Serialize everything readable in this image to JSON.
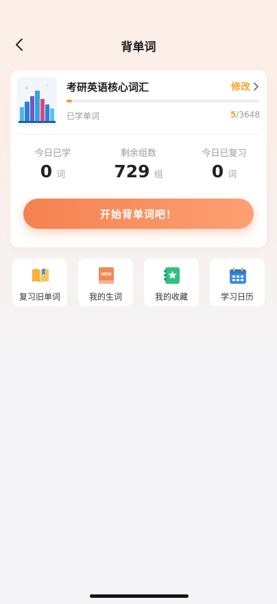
{
  "nav": {
    "title": "背单词"
  },
  "book": {
    "title": "考研英语核心词汇",
    "edit_label": "修改",
    "learned_label": "已学单词",
    "learned": "5",
    "separator": "/",
    "total": "3648",
    "progress_fraction": 0.0014
  },
  "stats": [
    {
      "label": "今日已学",
      "value": "0",
      "unit": "词"
    },
    {
      "label": "剩余组数",
      "value": "729",
      "unit": "组"
    },
    {
      "label": "今日已复习",
      "value": "0",
      "unit": "词"
    }
  ],
  "start_button": {
    "label": "开始背单词吧！"
  },
  "quick_actions": [
    {
      "label": "复习旧单词",
      "icon": "book-review-icon",
      "color": "#f3b33d"
    },
    {
      "label": "我的生词",
      "icon": "new-words-book-icon",
      "color": "#ef8a55"
    },
    {
      "label": "我的收藏",
      "icon": "star-notebook-icon",
      "color": "#2cc27e"
    },
    {
      "label": "学习日历",
      "icon": "calendar-icon",
      "color": "#3b8de6"
    }
  ],
  "colors": {
    "accent_orange": "#f0a62e",
    "button_start": "#f58150",
    "button_end": "#fca073"
  }
}
